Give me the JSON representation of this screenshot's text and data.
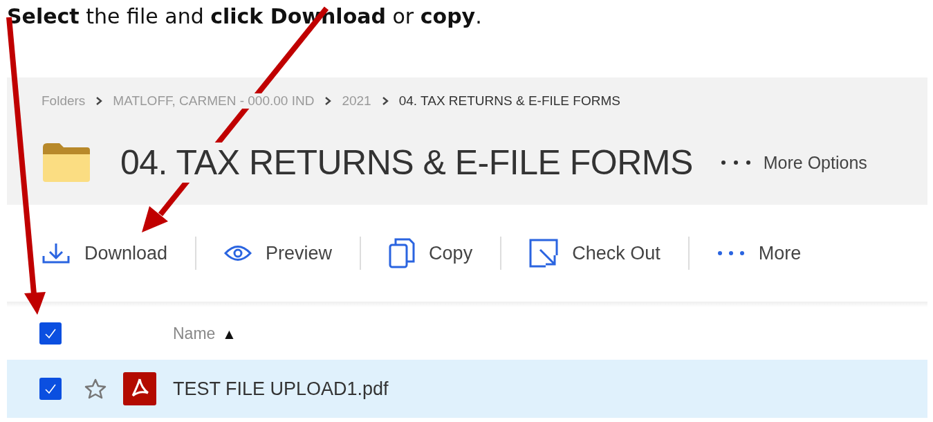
{
  "instruction": "**Select** the file and **click Download** or **copy**.",
  "breadcrumb": [
    {
      "label": "Folders",
      "current": false
    },
    {
      "label": "MATLOFF, CARMEN - 000.00 IND",
      "current": false
    },
    {
      "label": "2021",
      "current": false
    },
    {
      "label": "04. TAX RETURNS & E-FILE FORMS",
      "current": true
    }
  ],
  "folder_title": "04. TAX RETURNS & E-FILE FORMS",
  "more_options": "More Options",
  "toolbar": [
    {
      "kind": "download",
      "label": "Download"
    },
    {
      "kind": "preview",
      "label": "Preview"
    },
    {
      "kind": "copy",
      "label": "Copy"
    },
    {
      "kind": "checkout",
      "label": "Check Out"
    },
    {
      "kind": "more",
      "label": "More"
    }
  ],
  "table": {
    "select_all_checked": true,
    "columns": [
      {
        "label": "Name",
        "sort_indicator": "▲"
      }
    ],
    "rows": [
      {
        "name": "TEST FILE UPLOAD1.pdf",
        "checked": true,
        "selected": true,
        "starred": false
      }
    ]
  }
}
